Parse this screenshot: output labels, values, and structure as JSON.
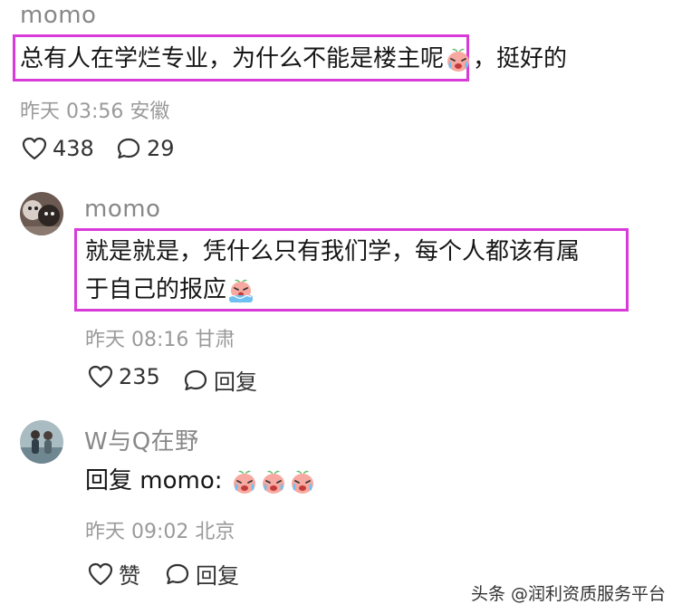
{
  "comments": [
    {
      "username": "momo",
      "text_highlighted": "总有人在学烂专业，为什么不能是楼主呢",
      "text_rest": "，挺好的",
      "meta": "昨天 03:56 安徽",
      "like_count": "438",
      "reply_count": "29"
    },
    {
      "username": "momo",
      "text_line1": "就是就是，凭什么只有我们学，每个人都该有属",
      "text_line2": "于自己的报应",
      "meta": "昨天 08:16 甘肃",
      "like_count": "235",
      "reply_label": "回复"
    },
    {
      "username": "W与Q在野",
      "reply_prefix": "回复 momo: ",
      "meta": "昨天 09:02 北京",
      "like_label": "赞",
      "reply_label": "回复"
    }
  ],
  "watermark": "头条 @润利资质服务平台",
  "colors": {
    "highlight_border": "#d83bd8",
    "username": "#888888",
    "meta": "#9a9a9a"
  }
}
